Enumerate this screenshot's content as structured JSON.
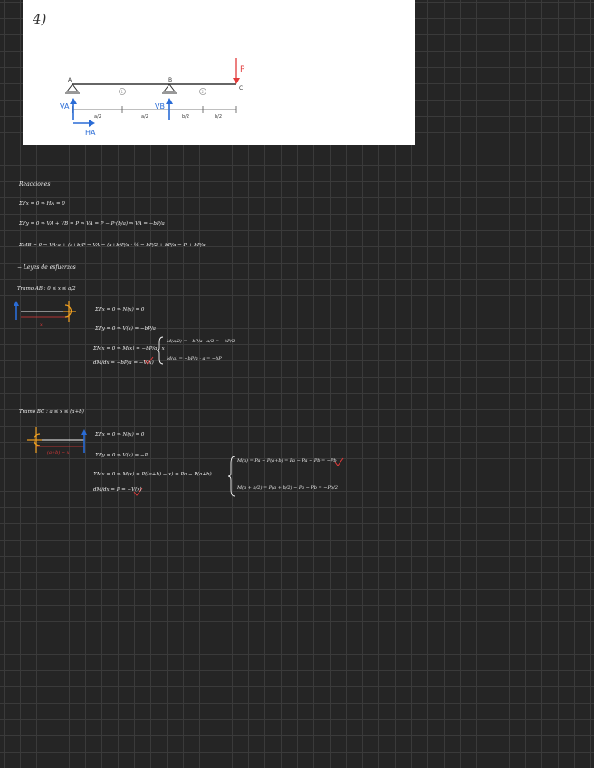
{
  "problem": {
    "number": "4)",
    "labels": {
      "A": "A",
      "B": "B",
      "C": "C",
      "P": "P",
      "one": "1",
      "two": "2",
      "dim1": "a/2",
      "dim2": "a/2",
      "dim3": "b/2",
      "dim4": "b/2",
      "VA": "VA",
      "VB": "VB",
      "HA": "HA"
    }
  },
  "notes": {
    "reactions_title": "Reacciones",
    "eq1": "ΣFx = 0 ⇒ HA = 0",
    "eq2": "ΣFy = 0 ⇒ VA + VB = P ⇒ VA = P − P·(b/a) ⇒ VA = −bP/a",
    "eq3": "ΣMB = 0 ⇒ VA·a + (a+b)P ⇒ VA = (a+b)P/a · ½ = bP/2 + bP/a = P + bP/a",
    "laws_title": "− Leyes de esfuerzos",
    "trama_ab": "Tramo AB : 0 ≤ x ≤ a/2",
    "ab_eq1": "ΣFx = 0 ⇒ N(x) = 0",
    "ab_eq2": "ΣFy = 0 ⇒ V(x) = −bP/a",
    "ab_eq3": "ΣMx = 0 ⇒ M(x) = −bP/a · x",
    "ab_eq4": "dM/dx = −bP/a = −V(x)",
    "ab_m1": "M(a/2) = −bP/a · a/2 = −bP/2",
    "ab_m2": "M(a) = −bP/a · a = −bP",
    "ab_x": "x",
    "trama_bc": "Tramo BC : a ≤ x ≤ (a+b)",
    "bc_x": "(a+b) − x",
    "bc_eq1": "ΣFx = 0 ⇒ N(x) = 0",
    "bc_eq2": "ΣFy = 0 ⇒ V(x) = −P",
    "bc_eq3": "ΣMx = 0 ⇒ M(x) = P((a+b) − x) = Pa − P(a+b)",
    "bc_eq4": "dM/dx = P = −V(x)",
    "bc_m1": "M(a) = Pa − P(a+b) = Pa − Pa − Pb = −Pb",
    "bc_m2": "M(a + b/2) = P(a + b/2) − Pa − Pb = −Pb/2"
  },
  "colors": {
    "background": "#252525",
    "grid": "#3a3a3a",
    "ink": "#f4f4f4",
    "red": "#e23a3a",
    "blue": "#2a6cd6",
    "orange": "#f0a020"
  }
}
